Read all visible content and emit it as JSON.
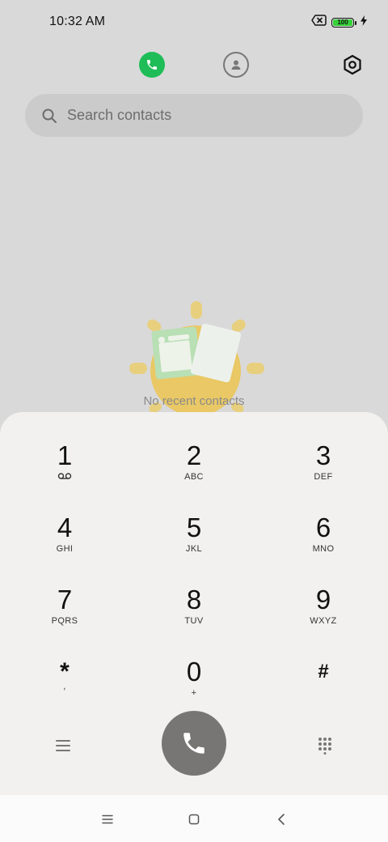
{
  "status_bar": {
    "time": "10:32 AM",
    "battery": "100",
    "icons": [
      "no-sim-icon",
      "battery-icon",
      "charging-icon"
    ]
  },
  "header": {
    "tabs": [
      {
        "icon": "phone-icon",
        "active": true
      },
      {
        "icon": "contacts-icon",
        "active": false
      }
    ],
    "settings_icon": "settings-icon"
  },
  "search": {
    "placeholder": "Search contacts",
    "icon": "search-icon"
  },
  "empty_state": {
    "text": "No recent contacts"
  },
  "dialpad": {
    "keys": [
      {
        "digit": "1",
        "sub": "",
        "sub_icon": "voicemail-icon"
      },
      {
        "digit": "2",
        "sub": "ABC"
      },
      {
        "digit": "3",
        "sub": "DEF"
      },
      {
        "digit": "4",
        "sub": "GHI"
      },
      {
        "digit": "5",
        "sub": "JKL"
      },
      {
        "digit": "6",
        "sub": "MNO"
      },
      {
        "digit": "7",
        "sub": "PQRS"
      },
      {
        "digit": "8",
        "sub": "TUV"
      },
      {
        "digit": "9",
        "sub": "WXYZ"
      },
      {
        "digit": "*",
        "sub": ","
      },
      {
        "digit": "0",
        "sub": "+"
      },
      {
        "digit": "#",
        "sub": ""
      }
    ],
    "call_button_icon": "phone-icon",
    "menu_icon": "menu-icon",
    "keypad_icon": "dialpad-icon"
  },
  "colors": {
    "background": "#d9d9d9",
    "accent_green": "#1fbd57",
    "dialpad_bg": "#f2f1ef",
    "call_button": "#777674"
  },
  "nav_bar": {
    "buttons": [
      "menu-icon",
      "home-icon",
      "back-icon"
    ]
  }
}
